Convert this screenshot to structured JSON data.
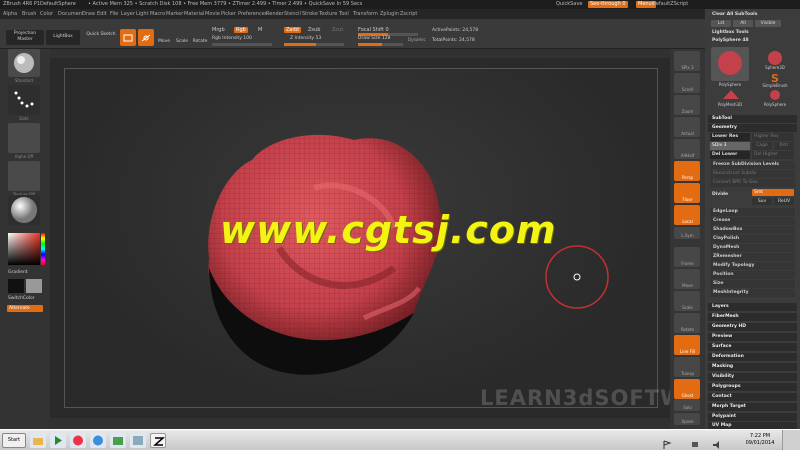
{
  "titlebar": {
    "app": "ZBrush 4R6 P1",
    "doc": "DefaultSphere",
    "stats": "• Active Mem 325 • Scratch Disk 108 • Free Mem 3779 • ZTimer 2.499 • Timer 2.499 • QuickSave In 59 Secs",
    "quicksave": "QuickSave",
    "seethrough": "See-through 0",
    "menus": "Menus",
    "script": "DefaultZScript"
  },
  "menubar": {
    "items": [
      "Alpha",
      "Brush",
      "Color",
      "Document",
      "Draw",
      "Edit",
      "File",
      "Layer",
      "Light",
      "Macro",
      "Marker",
      "Material",
      "Movie",
      "Picker",
      "Preferences",
      "Render",
      "Stencil",
      "Stroke",
      "Texture",
      "Tool",
      "Transform",
      "Zplugin",
      "Zscript"
    ]
  },
  "shelf": {
    "projection_master": "Projection Master",
    "lightbox": "LightBox",
    "quick_sketch": "Quick Sketch",
    "edit": "Edit",
    "draw": "Draw",
    "move": "Move",
    "scale": "Scale",
    "rotate": "Rotate",
    "mrgb": "Mrgb",
    "rgb": "Rgb",
    "m": "M",
    "zadd": "Zadd",
    "zsub": "Zsub",
    "zcut": "Zcut",
    "rgb_intensity": "Rgb Intensity 100",
    "z_intensity": "Z Intensity 53",
    "focal_shift": "Focal Shift 0",
    "draw_size": "Draw Size 128",
    "dynamic": "Dynamic",
    "active_points": "ActivePoints: 24,578",
    "total_points": "TotalPoints: 24,578"
  },
  "lefttray": {
    "labels": [
      "Standard",
      "Dots",
      "Alpha Off",
      "Texture Off",
      "Gradient",
      "SwitchColor",
      "Alternate"
    ]
  },
  "rightshelf": {
    "labels": [
      "SPix 3",
      "Scroll",
      "Zoom",
      "Actual",
      "AAHalf",
      "Persp",
      "Floor",
      "Local",
      "L.Sym",
      "Frame",
      "Move",
      "Scale",
      "Rotate",
      "Line Fill",
      "Transp",
      "Ghost",
      "Solo",
      "Xpose"
    ]
  },
  "rightpanel": {
    "top": [
      "Clear All SubTools",
      "Lst",
      "All",
      "Visible",
      "Lightbox Tools",
      "PolySphere 48"
    ],
    "tools": [
      "PolySphere",
      "Sphere3D",
      "SimpleBrush",
      "PolyMesh3D",
      "PolySphere"
    ],
    "subtool": "SubTool",
    "geometry": "Geometry",
    "lower_res": "Lower Res",
    "higher_res": "Higher Res",
    "sdiv": "SDiv 3",
    "cage": "Cage",
    "rstr": "Rstr",
    "del_lower": "Del Lower",
    "del_higher": "Del Higher",
    "freeze": "Freeze SubDivision Levels",
    "reconstruct": "Reconstruct Subdiv",
    "convert": "Convert BPR To Geo",
    "divide": "Divide",
    "smt": "Smt",
    "suv": "Suv",
    "reuv": "ReUV",
    "sections": [
      "EdgeLoop",
      "Crease",
      "ShadowBox",
      "ClayPolish",
      "DynaMesh",
      "ZRemesher",
      "Modify Topology",
      "Position",
      "Size",
      "MeshIntegrity"
    ],
    "more": [
      "Layers",
      "FiberMesh",
      "Geometry HD",
      "Preview",
      "Surface",
      "Deformation",
      "Masking",
      "Visibility",
      "Polygroups",
      "Contact",
      "Morph Target",
      "Polypaint",
      "UV Map"
    ]
  },
  "watermarks": {
    "site": "www.cgtsj.com",
    "brand": "LEARN3dSOFTWARE.com"
  },
  "taskbar": {
    "start": "Start",
    "time": "7:22 PM",
    "date": "09/01/2014"
  },
  "colors": {
    "accent": "#e36b12",
    "mesh": "#c8444a",
    "watermark": "#f4f414"
  }
}
